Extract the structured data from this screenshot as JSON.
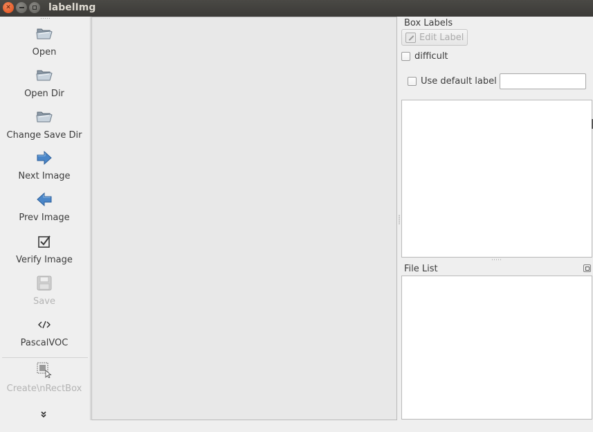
{
  "window": {
    "title": "labelImg"
  },
  "toolbar": {
    "items": [
      {
        "label": "Open",
        "icon": "folder-open-icon",
        "enabled": true
      },
      {
        "label": "Open Dir",
        "icon": "folder-open-icon",
        "enabled": true
      },
      {
        "label": "Change Save Dir",
        "icon": "folder-open-icon",
        "enabled": true
      },
      {
        "label": "Next Image",
        "icon": "arrow-right-icon",
        "enabled": true
      },
      {
        "label": "Prev Image",
        "icon": "arrow-left-icon",
        "enabled": true
      },
      {
        "label": "Verify Image",
        "icon": "checkbox-checked-icon",
        "enabled": true
      },
      {
        "label": "Save",
        "icon": "floppy-disk-icon",
        "enabled": false
      },
      {
        "label": "PascalVOC",
        "icon": "code-tag-icon",
        "enabled": true
      },
      {
        "label": "Create\\nRectBox",
        "icon": "rect-cursor-icon",
        "enabled": false
      }
    ],
    "overflow_icon": "chevron-double-down-icon"
  },
  "box_labels": {
    "title": "Box Labels",
    "edit_label_button": "Edit Label",
    "difficult_label": "difficult",
    "difficult_checked": false,
    "use_default_label": "Use default label",
    "use_default_checked": false,
    "default_label_value": ""
  },
  "file_list": {
    "title": "File List",
    "files": []
  },
  "colors": {
    "titlebar": "#3c3b37",
    "close_button": "#e95420",
    "canvas_bg": "#e8e8e8",
    "panel_bg": "#efefef",
    "arrow_blue": "#3f7fc9"
  }
}
